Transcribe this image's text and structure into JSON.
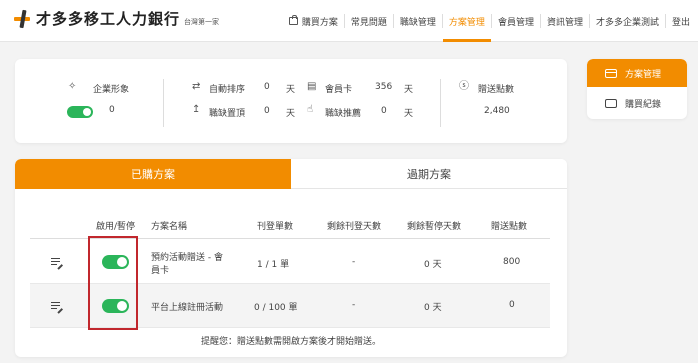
{
  "header": {
    "brand_name": "才多多移工人力銀行",
    "brand_tagline": "台灣第一家",
    "nav": [
      "購買方案",
      "常見問題",
      "職缺管理",
      "方案管理",
      "會員管理",
      "資訊管理",
      "才多多企業測試",
      "登出"
    ],
    "active_nav": "方案管理"
  },
  "stats": {
    "corporate_image_label": "企業形象",
    "corporate_image_value": "0",
    "auto_sort_label": "自動排序",
    "auto_sort_value": "0",
    "auto_sort_unit": "天",
    "pin_top_label": "職缺置頂",
    "pin_top_value": "0",
    "pin_top_unit": "天",
    "member_card_label": "會員卡",
    "member_card_value": "356",
    "member_card_unit": "天",
    "recommend_label": "職缺推薦",
    "recommend_value": "0",
    "recommend_unit": "天",
    "bonus_points_label": "贈送點數",
    "bonus_points_value": "2,480"
  },
  "sidebar": {
    "items": [
      {
        "label": "方案管理",
        "icon": "credit-card-icon",
        "active": true
      },
      {
        "label": "購買紀錄",
        "icon": "receipt-icon",
        "active": false
      }
    ]
  },
  "tabs": [
    "已購方案",
    "過期方案"
  ],
  "table": {
    "headers": [
      "啟用/暫停",
      "方案名稱",
      "刊登單數",
      "剩餘刊登天數",
      "剩餘暫停天數",
      "贈送點數"
    ],
    "rows": [
      {
        "plan_name_line1": "預約活動贈送 - 會",
        "plan_name_line2": "員卡",
        "posting_count": "1 / 1 單",
        "remaining_days": "-",
        "paused_days": "0 天",
        "bonus_points": "800",
        "enabled": true
      },
      {
        "plan_name_line1": "平台上線註冊活動",
        "plan_name_line2": "",
        "posting_count": "0 / 100 單",
        "remaining_days": "-",
        "paused_days": "0 天",
        "bonus_points": "0",
        "enabled": true
      }
    ]
  },
  "notice": "提醒您：贈送點數需開啟方案後才開始贈送。",
  "colors": {
    "accent": "#f28c00",
    "toggle_on": "#2bb55a",
    "highlight": "#c1272d"
  }
}
